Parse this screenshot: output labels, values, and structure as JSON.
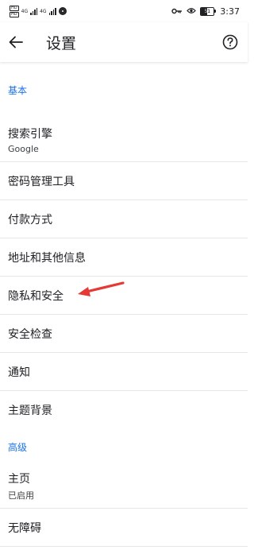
{
  "status_bar": {
    "sim1_label": "HD",
    "sim2_label": "HD",
    "network_type_1": "4G",
    "network_type_2": "4G",
    "battery_level": "51",
    "time": "3:37",
    "icons": [
      "sim-icon",
      "signal-icon",
      "app-notification-icon",
      "key-icon",
      "eye-icon",
      "battery-icon"
    ]
  },
  "toolbar": {
    "back_icon": "back-arrow-icon",
    "title": "设置",
    "help_icon": "help-icon"
  },
  "sections": {
    "basic": {
      "header": "基本",
      "items": [
        {
          "title": "搜索引擎",
          "subtitle": "Google"
        },
        {
          "title": "密码管理工具"
        },
        {
          "title": "付款方式"
        },
        {
          "title": "地址和其他信息"
        },
        {
          "title": "隐私和安全"
        },
        {
          "title": "安全检查"
        },
        {
          "title": "通知"
        },
        {
          "title": "主题背景"
        }
      ]
    },
    "advanced": {
      "header": "高级",
      "items": [
        {
          "title": "主页",
          "subtitle": "已启用"
        },
        {
          "title": "无障碍"
        }
      ]
    }
  },
  "annotation": {
    "type": "arrow",
    "color": "#e53935",
    "target": "隐私和安全"
  },
  "colors": {
    "accent": "#1a73e8",
    "divider": "#e6e6e6",
    "text": "#202124"
  }
}
